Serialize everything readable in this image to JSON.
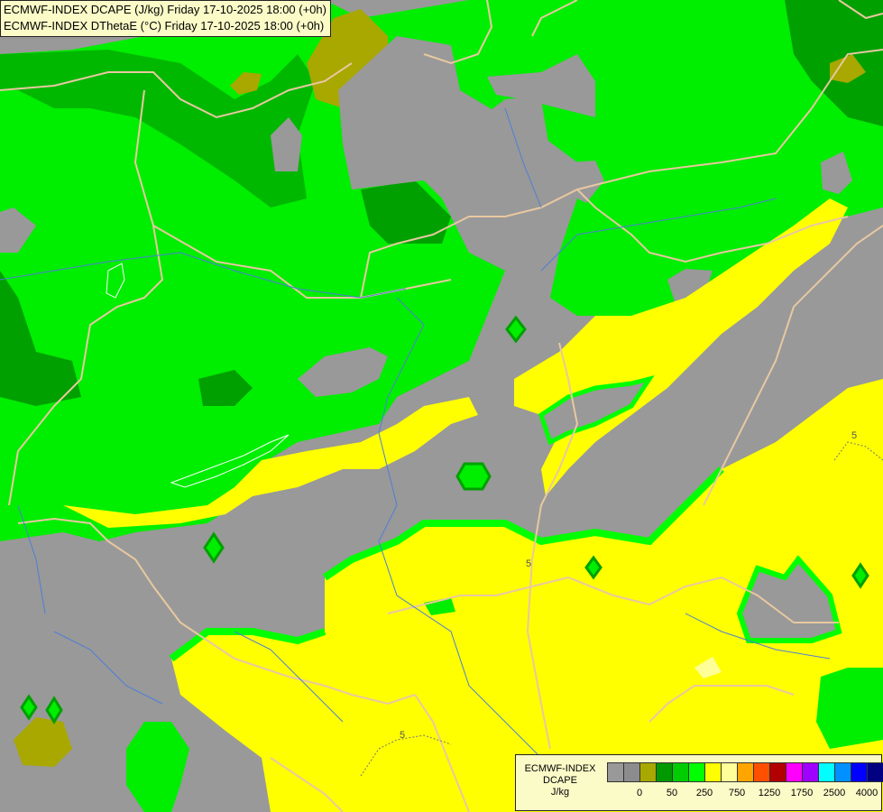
{
  "header": {
    "line1": "ECMWF-INDEX DCAPE (J/kg) Friday 17-10-2025 18:00 (+0h)",
    "line2": "ECMWF-INDEX DThetaE (°C) Friday 17-10-2025 18:00 (+0h)"
  },
  "legend": {
    "title_line1": "ECMWF-INDEX",
    "title_line2": "DCAPE",
    "unit": "J/kg",
    "colors": [
      "#999999",
      "#8c8c8c",
      "#a8a800",
      "#009900",
      "#00cc00",
      "#00ff00",
      "#ffff00",
      "#ffff99",
      "#ffa500",
      "#ff5000",
      "#b20000",
      "#ff00ff",
      "#a000ff",
      "#00ffff",
      "#0090ff",
      "#0000ff",
      "#000080"
    ],
    "tick_labels": [
      "0",
      "50",
      "250",
      "750",
      "1250",
      "1750",
      "2500",
      "4000"
    ]
  },
  "map_labels": {
    "contour_5_a": "5",
    "contour_5_b": "5",
    "contour_5_c": "5"
  },
  "map_colors": {
    "gray": "#999999",
    "olive": "#a8a800",
    "dark_green": "#009900",
    "green": "#00cc00",
    "light_green": "#00ff00",
    "yellow": "#ffff00",
    "border": "#e8c8a0",
    "river": "#4d7fd6"
  }
}
